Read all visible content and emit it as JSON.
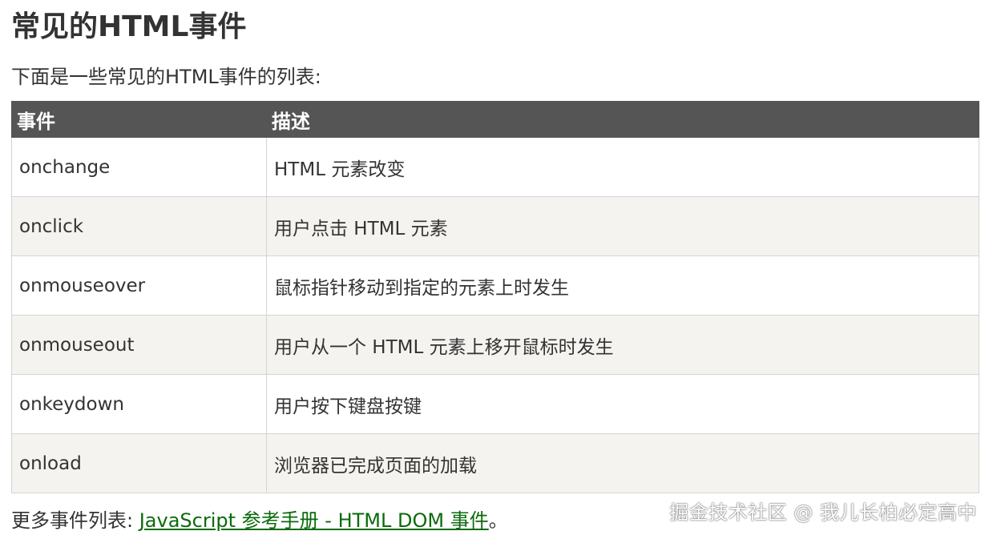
{
  "heading": {
    "title": "常见的HTML事件"
  },
  "intro": {
    "text": "下面是一些常见的HTML事件的列表:"
  },
  "table": {
    "headers": [
      "事件",
      "描述"
    ],
    "rows": [
      {
        "event": "onchange",
        "description": "HTML 元素改变"
      },
      {
        "event": "onclick",
        "description": "用户点击 HTML 元素"
      },
      {
        "event": "onmouseover",
        "description": "鼠标指针移动到指定的元素上时发生"
      },
      {
        "event": "onmouseout",
        "description": "用户从一个 HTML 元素上移开鼠标时发生"
      },
      {
        "event": "onkeydown",
        "description": "用户按下键盘按键"
      },
      {
        "event": "onload",
        "description": "浏览器已完成页面的加载"
      }
    ]
  },
  "footer": {
    "prefix": "更多事件列表: ",
    "link_text": "JavaScript 参考手册 - HTML DOM 事件",
    "suffix": "。"
  },
  "watermark": {
    "text": "掘金技术社区 @ 我儿长柏必定高中"
  },
  "colors": {
    "header_bg": "#555555",
    "row_alt_bg": "#f4f3ef",
    "link": "#0b6b0b",
    "text": "#333333"
  }
}
